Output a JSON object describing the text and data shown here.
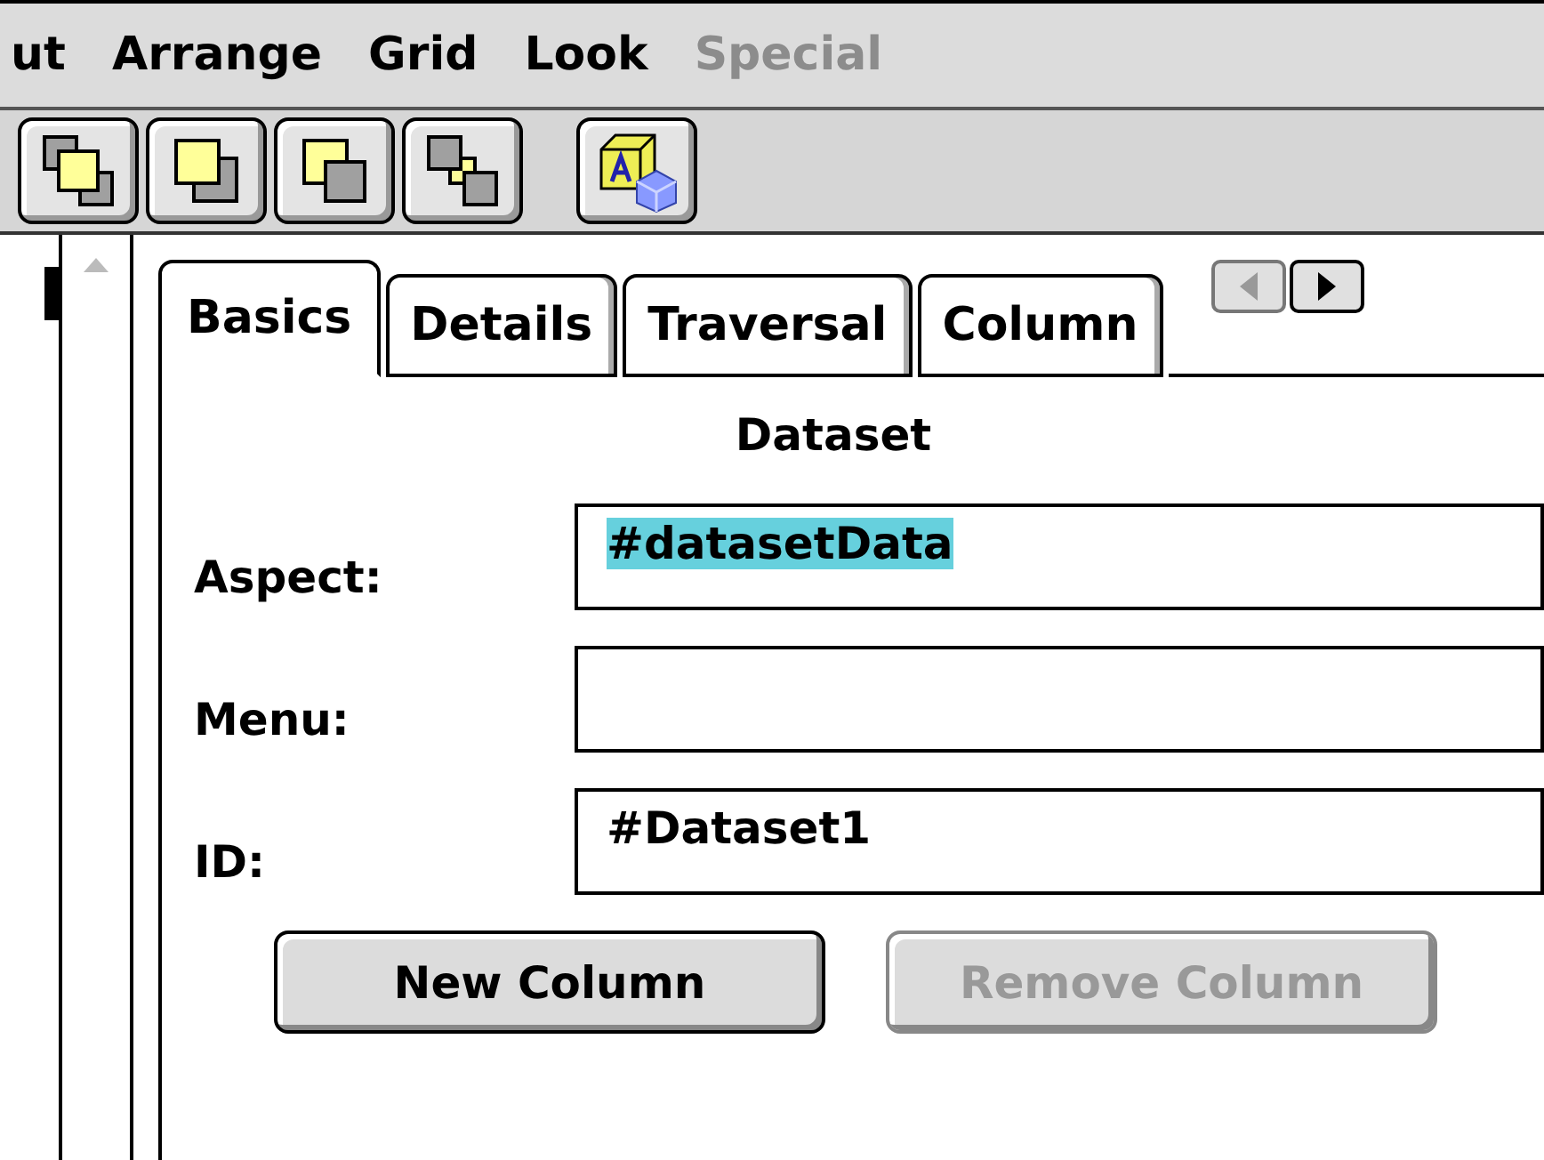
{
  "menu_bar": [
    {
      "label": "ut",
      "disabled": false
    },
    {
      "label": "Arrange",
      "disabled": false
    },
    {
      "label": "Grid",
      "disabled": false
    },
    {
      "label": "Look",
      "disabled": false
    },
    {
      "label": "Special",
      "disabled": true
    }
  ],
  "toolbar": [
    {
      "kind": "front"
    },
    {
      "kind": "back"
    },
    {
      "kind": "forward"
    },
    {
      "kind": "backward"
    },
    {
      "kind": "object"
    }
  ],
  "tabs": [
    {
      "label": "Basics",
      "selected": true
    },
    {
      "label": "Details",
      "selected": false
    },
    {
      "label": "Traversal",
      "selected": false
    },
    {
      "label": "Column",
      "selected": false
    }
  ],
  "tab_scroll": [
    {
      "kind": "left",
      "disabled": true
    },
    {
      "kind": "right",
      "disabled": false
    }
  ],
  "section_title": "Dataset",
  "fields": [
    {
      "label": "Aspect:",
      "value": "#datasetData",
      "highlighted": true
    },
    {
      "label": "Menu:"
    },
    {
      "label": "ID:",
      "value": "#Dataset1",
      "highlighted": false
    }
  ],
  "buttons": [
    {
      "label": "New Column",
      "disabled": false
    },
    {
      "label": "Remove Column",
      "disabled": true
    }
  ]
}
